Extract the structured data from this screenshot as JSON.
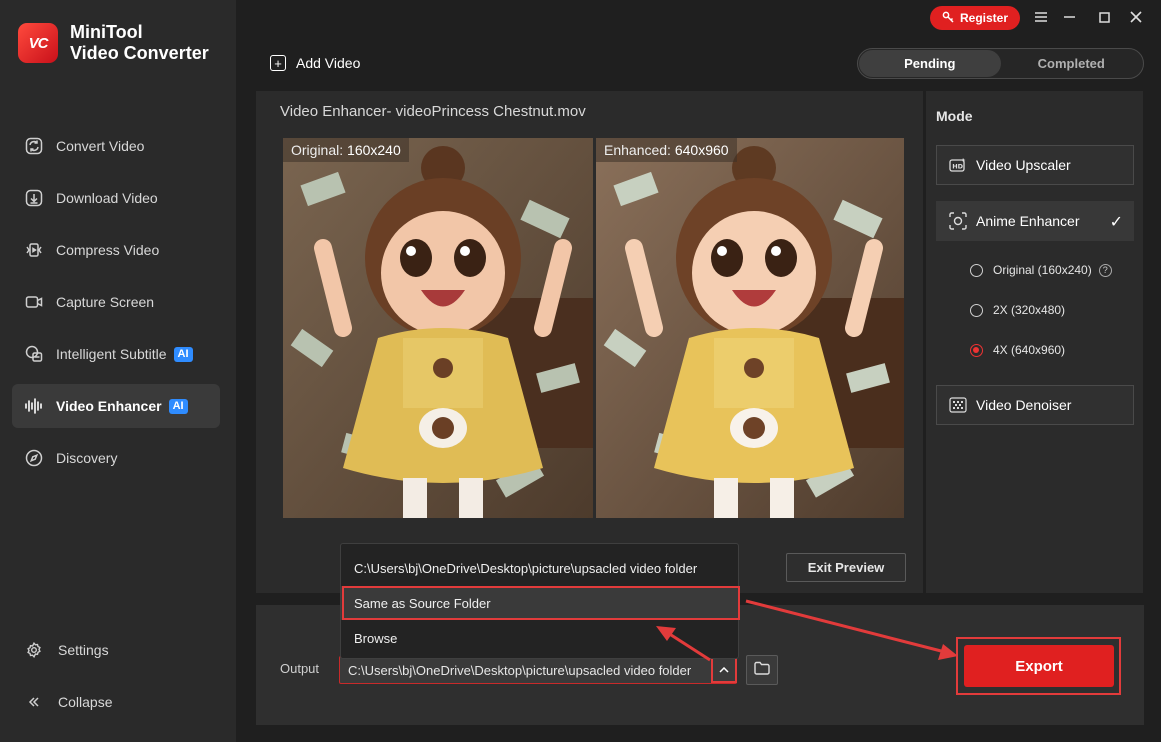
{
  "app": {
    "logo_text": "VC",
    "name_line1": "MiniTool",
    "name_line2": "Video Converter"
  },
  "sidebar": {
    "items": [
      {
        "label": "Convert Video",
        "icon": "convert-icon"
      },
      {
        "label": "Download Video",
        "icon": "download-icon"
      },
      {
        "label": "Compress Video",
        "icon": "compress-icon"
      },
      {
        "label": "Capture Screen",
        "icon": "camera-icon"
      },
      {
        "label": "Intelligent Subtitle",
        "icon": "subtitle-icon",
        "badge": "AI"
      },
      {
        "label": "Video Enhancer",
        "icon": "enhancer-icon",
        "badge": "AI",
        "active": true
      },
      {
        "label": "Discovery",
        "icon": "compass-icon"
      }
    ],
    "settings_label": "Settings",
    "collapse_label": "Collapse"
  },
  "topbar": {
    "register_label": "Register",
    "add_video_label": "Add Video",
    "tabs": [
      {
        "label": "Pending",
        "active": true
      },
      {
        "label": "Completed",
        "active": false
      }
    ]
  },
  "preview": {
    "title": "Video Enhancer- videoPrincess Chestnut.mov",
    "original_label": "Original:",
    "original_value": "160x240",
    "enhanced_label": "Enhanced:",
    "enhanced_value": "640x960",
    "exit_label": "Exit Preview"
  },
  "modes": {
    "title": "Mode",
    "upscaler_label": "Video Upscaler",
    "anime_label": "Anime Enhancer",
    "denoiser_label": "Video Denoiser",
    "options": [
      {
        "label": "Original (160x240)",
        "selected": false
      },
      {
        "label": "2X (320x480)",
        "selected": false
      },
      {
        "label": "4X (640x960)",
        "selected": true
      }
    ]
  },
  "output": {
    "label": "Output",
    "path": "C:\\Users\\bj\\OneDrive\\Desktop\\picture\\upsacled video folder",
    "export_label": "Export",
    "dropdown": [
      "C:\\Users\\bj\\OneDrive\\Desktop\\picture\\upsacled video folder",
      "Same as Source Folder",
      "Browse"
    ]
  },
  "colors": {
    "accent": "#e02020",
    "ai_badge": "#2f8cff",
    "sidebar_bg": "#2a2a2a"
  }
}
